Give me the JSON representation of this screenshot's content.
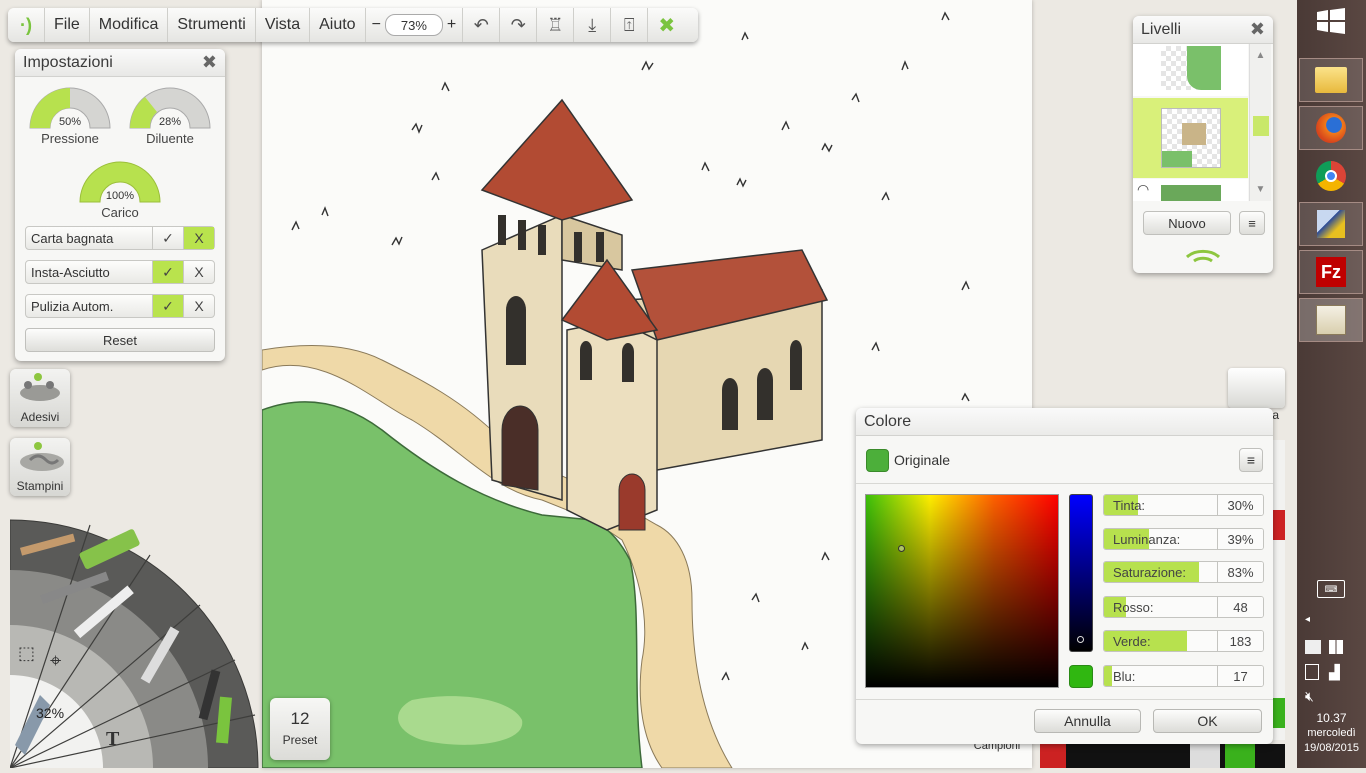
{
  "toolbar": {
    "menus": [
      "File",
      "Modifica",
      "Strumenti",
      "Vista",
      "Aiuto"
    ],
    "zoom_minus": "−",
    "zoom_value": "73%",
    "zoom_plus": "+"
  },
  "settings": {
    "title": "Impostazioni",
    "gauges": [
      {
        "label": "Pressione",
        "value": "50%"
      },
      {
        "label": "Diluente",
        "value": "28%"
      },
      {
        "label": "Carico",
        "value": "100%"
      }
    ],
    "toggles": [
      {
        "label": "Carta bagnata",
        "check": "✓",
        "cross": "X",
        "state": "off"
      },
      {
        "label": "Insta-Asciutto",
        "check": "✓",
        "cross": "X",
        "state": "on"
      },
      {
        "label": "Pulizia Autom.",
        "check": "✓",
        "cross": "X",
        "state": "on"
      }
    ],
    "reset_label": "Reset"
  },
  "side_tools": {
    "adesivi": "Adesivi",
    "stampini": "Stampini"
  },
  "toolwheel": {
    "zoom_percent": "32%"
  },
  "preset": {
    "count": "12",
    "label": "Preset"
  },
  "layers": {
    "title": "Livelli",
    "new_label": "Nuovo"
  },
  "color_dialog": {
    "title": "Colore",
    "original_label": "Originale",
    "sliders": [
      {
        "label": "Tinta:",
        "value": "30%",
        "fill": 0.3
      },
      {
        "label": "Luminanza:",
        "value": "39%",
        "fill": 0.39
      },
      {
        "label": "Saturazione:",
        "value": "83%",
        "fill": 0.83
      },
      {
        "label": "Rosso:",
        "value": "48",
        "fill": 0.188
      },
      {
        "label": "Verde:",
        "value": "183",
        "fill": 0.718
      },
      {
        "label": "Blu:",
        "value": "17",
        "fill": 0.067
      }
    ],
    "cancel_label": "Annulla",
    "ok_label": "OK",
    "selected_color": "#30b711"
  },
  "behind_panels": {
    "campioni_label": "Campioni",
    "swatch_partial": "a"
  },
  "taskbar": {
    "time": "10.37",
    "day": "mercoledì",
    "date": "19/08/2015"
  },
  "colors": {
    "accent_green": "#b9e34d",
    "brand_green": "#6fcf3c"
  }
}
